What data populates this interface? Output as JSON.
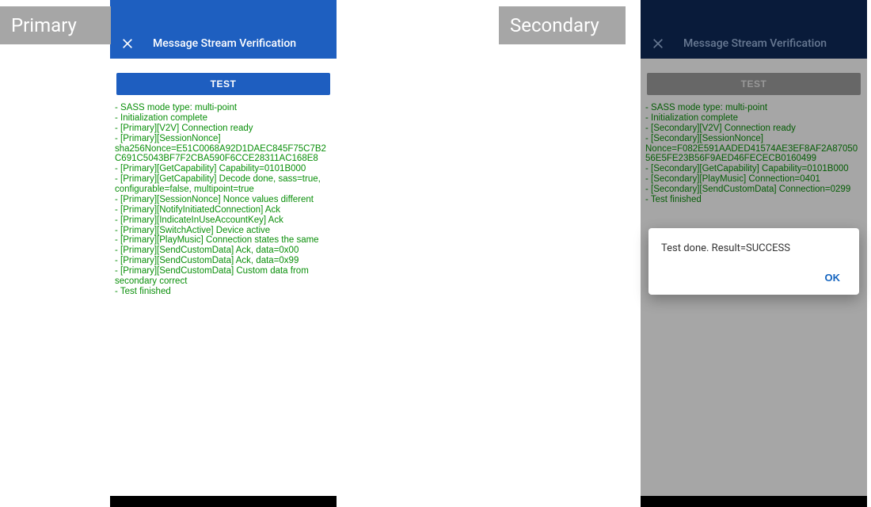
{
  "badges": {
    "primary": "Primary",
    "secondary": "Secondary"
  },
  "app_bar": {
    "title": "Message Stream Verification"
  },
  "test_button": {
    "label": "TEST"
  },
  "dialog": {
    "text": "Test done. Result=SUCCESS",
    "ok": "OK"
  },
  "primary_log": [
    "- SASS mode type: multi-point",
    "- Initialization complete",
    "- [Primary][V2V] Connection ready",
    "- [Primary][SessionNonce] sha256Nonce=E51C0068A92D1DAEC845F75C7B2C691C5043BF7F2CBA590F6CCE28311AC168E8",
    "- [Primary][GetCapability] Capability=0101B000",
    "- [Primary][GetCapability] Decode done, sass=true, configurable=false, multipoint=true",
    "- [Primary][SessionNonce] Nonce values different",
    "- [Primary][NotifyInitiatedConnection] Ack",
    "- [Primary][IndicateInUseAccountKey] Ack",
    "- [Primary][SwitchActive] Device active",
    "- [Primary][PlayMusic] Connection states the same",
    "- [Primary][SendCustomData] Ack, data=0x00",
    "- [Primary][SendCustomData] Ack, data=0x99",
    "- [Primary][SendCustomData] Custom data from secondary correct",
    "- Test finished"
  ],
  "secondary_log": [
    "- SASS mode type: multi-point",
    "- Initialization complete",
    "- [Secondary][V2V] Connection ready",
    "- [Secondary][SessionNonce] Nonce=F082E591AADED41574AE3EF8AF2A8705056E5FE23B56F9AED46FECECB0160499",
    "- [Secondary][GetCapability] Capability=0101B000",
    "- [Secondary][PlayMusic] Connection=0401",
    "- [Secondary][SendCustomData] Connection=0299",
    "- Test finished"
  ]
}
